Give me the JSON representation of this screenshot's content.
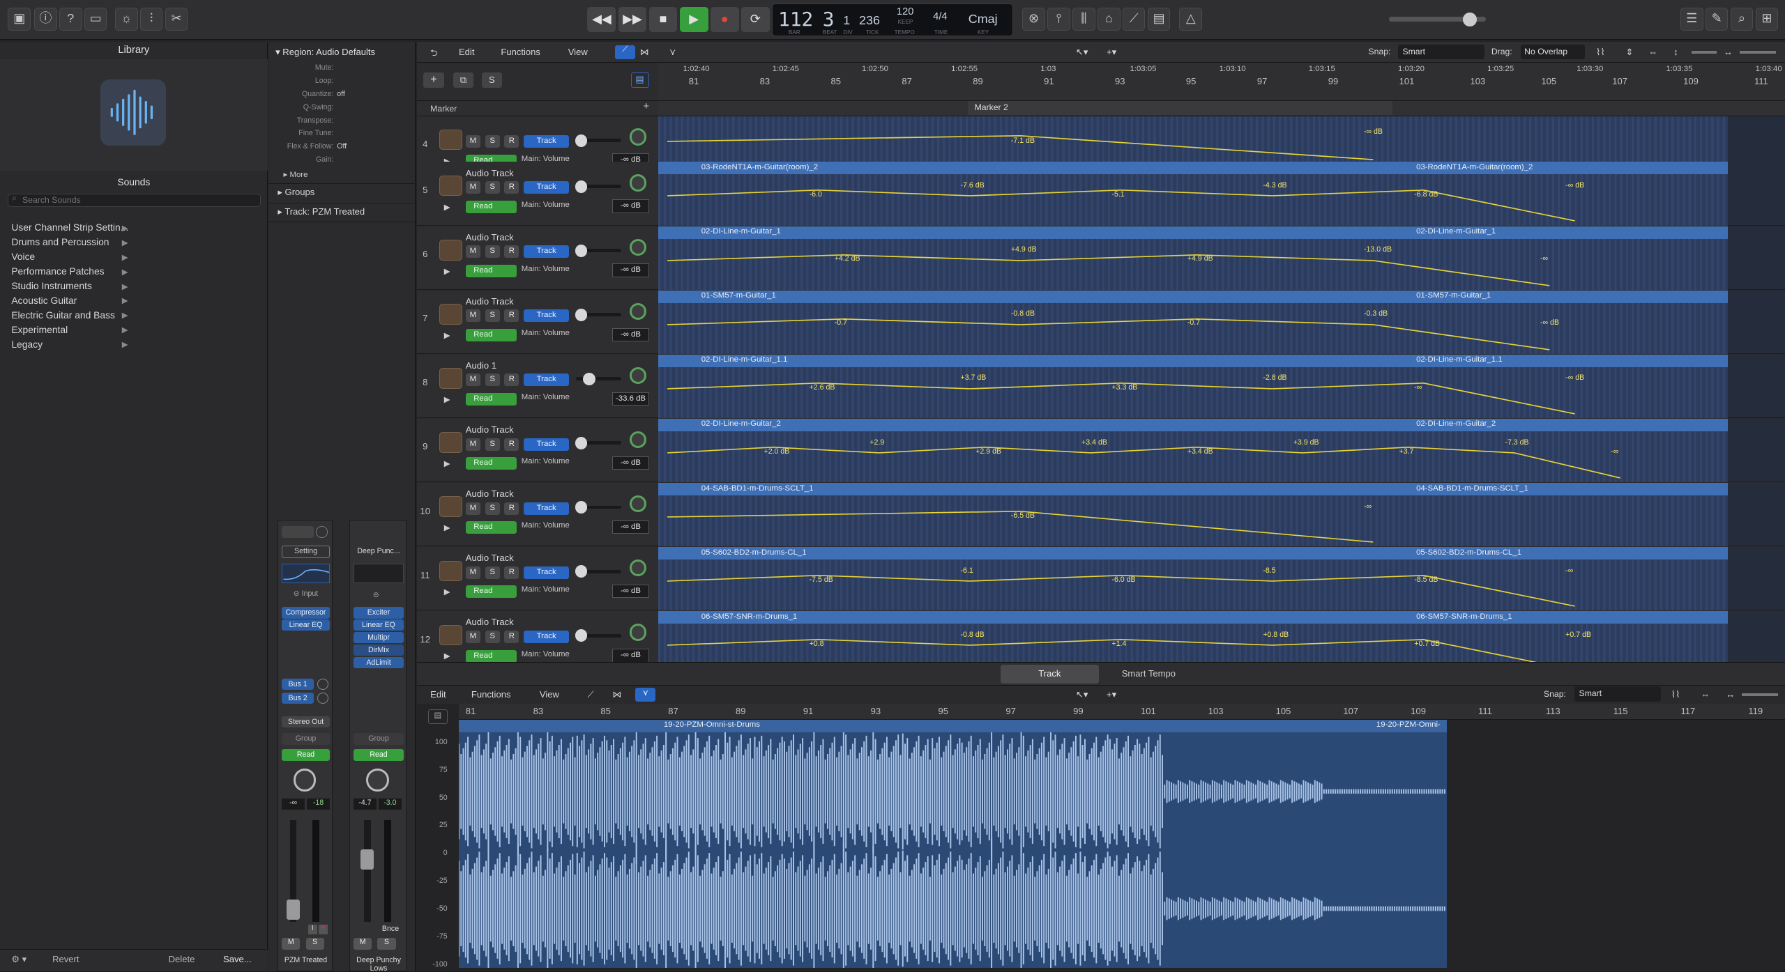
{
  "control_bar": {
    "lcd": {
      "bar": "112",
      "beat": "3",
      "div": "1",
      "tick": "236",
      "bar_lbl": "BAR",
      "beat_lbl": "BEAT",
      "div_lbl": "DIV",
      "tick_lbl": "TICK",
      "tempo": "120",
      "tempo_mode": "KEEP",
      "tempo_lbl": "TEMPO",
      "time_sig": "4/4",
      "time_lbl": "TIME",
      "key": "Cmaj",
      "key_lbl": "KEY"
    }
  },
  "library": {
    "title": "Library",
    "sounds": "Sounds",
    "search_placeholder": "Search Sounds",
    "items": [
      "User Channel Strip Settin...",
      "Drums and Percussion",
      "Voice",
      "Performance Patches",
      "Studio Instruments",
      "Acoustic Guitar",
      "Electric Guitar and Bass",
      "Experimental",
      "Legacy"
    ],
    "footer": {
      "revert": "Revert",
      "delete": "Delete",
      "save": "Save..."
    }
  },
  "inspector": {
    "region_header": "Region: Audio Defaults",
    "params": [
      {
        "label": "Mute:",
        "value": ""
      },
      {
        "label": "Loop:",
        "value": ""
      },
      {
        "label": "Quantize:",
        "value": "off"
      },
      {
        "label": "Q-Swing:",
        "value": ""
      },
      {
        "label": "Transpose:",
        "value": ""
      },
      {
        "label": "Fine Tune:",
        "value": ""
      },
      {
        "label": "Flex & Follow:",
        "value": "Off"
      },
      {
        "label": "Gain:",
        "value": ""
      }
    ],
    "more": "More",
    "groups": "Groups",
    "track_prefix": "Track:",
    "track_name": "PZM  Treated",
    "strip1": {
      "setting": "Setting",
      "input": "Input",
      "plugins": [
        "Compressor",
        "Linear EQ"
      ],
      "sends": [
        "Bus 1",
        "Bus 2"
      ],
      "output": "Stereo Out",
      "group": "Group",
      "read": "Read",
      "vol": "-∞",
      "peak": "-18",
      "m": "M",
      "s": "S",
      "i": "I",
      "r": "R",
      "name": "PZM  Treated"
    },
    "strip2": {
      "setting": "Deep Punc...",
      "plugins": [
        "Exciter",
        "Linear EQ",
        "Multipr",
        "DirMix",
        "AdLimit"
      ],
      "group": "Group",
      "read": "Read",
      "vol": "-4.7",
      "peak": "-3.0",
      "m": "M",
      "s": "S",
      "bnce": "Bnce",
      "name": "Deep Punchy Lows"
    }
  },
  "tracks_toolbar": {
    "edit": "Edit",
    "functions": "Functions",
    "view": "View",
    "snap_label": "Snap:",
    "snap": "Smart",
    "drag_label": "Drag:",
    "drag": "No Overlap",
    "marker": "Marker",
    "marker2": "Marker 2",
    "s": "S"
  },
  "ruler": {
    "times": [
      "1:02:40",
      "1:02:45",
      "1:02:50",
      "1:02:55",
      "1:03",
      "1:03:05",
      "1:03:10",
      "1:03:15",
      "1:03:20",
      "1:03:25",
      "1:03:30",
      "1:03:35",
      "1:03:40"
    ],
    "bars": [
      "81",
      "83",
      "85",
      "87",
      "89",
      "91",
      "93",
      "95",
      "97",
      "99",
      "101",
      "103",
      "105",
      "107",
      "109",
      "111"
    ]
  },
  "tracks": [
    {
      "num": "4",
      "name": "",
      "db": "-∞ dB",
      "regions": [],
      "labels": [
        "-7.1 dB",
        "-∞ dB"
      ]
    },
    {
      "num": "5",
      "name": "Audio Track",
      "db": "-∞ dB",
      "regions": [
        "03-RodeNT1A-m-Guitar(room)_2",
        "03-RodeNT1A-m-Guitar(room)_2"
      ],
      "labels": [
        "-6.0",
        "-7.6 dB",
        "-5.1",
        "-4.3 dB",
        "-6.8 dB",
        "-∞ dB"
      ]
    },
    {
      "num": "6",
      "name": "Audio Track",
      "db": "-∞ dB",
      "regions": [
        "02-DI-Line-m-Guitar_1",
        "02-DI-Line-m-Guitar_1"
      ],
      "labels": [
        "+4.2 dB",
        "+4.9 dB",
        "+4.9 dB",
        "-13.0 dB",
        "-∞"
      ]
    },
    {
      "num": "7",
      "name": "Audio Track",
      "db": "-∞ dB",
      "regions": [
        "01-SM57-m-Guitar_1",
        "01-SM57-m-Guitar_1"
      ],
      "labels": [
        "-0.7",
        "-0.8 dB",
        "-0.7",
        "-0.3 dB",
        "-∞ dB"
      ]
    },
    {
      "num": "8",
      "name": "Audio 1",
      "db": "-33.6 dB",
      "regions": [
        "02-DI-Line-m-Guitar_1.1",
        "02-DI-Line-m-Guitar_1.1"
      ],
      "labels": [
        "+2.6 dB",
        "+3.7 dB",
        "+3.3 dB",
        "-2.8 dB",
        "-∞",
        "-∞ dB"
      ]
    },
    {
      "num": "9",
      "name": "Audio Track",
      "db": "-∞ dB",
      "regions": [
        "02-DI-Line-m-Guitar_2",
        "02-DI-Line-m-Guitar_2"
      ],
      "labels": [
        "+2.0 dB",
        "+2.9",
        "+2.9 dB",
        "+3.4 dB",
        "+3.4 dB",
        "+3.9 dB",
        "+3.7",
        "-7.3 dB",
        "-∞"
      ]
    },
    {
      "num": "10",
      "name": "Audio Track",
      "db": "-∞ dB",
      "regions": [
        "04-SAB-BD1-m-Drums-SCLT_1",
        "04-SAB-BD1-m-Drums-SCLT_1"
      ],
      "labels": [
        "-6.5 dB",
        "-∞"
      ]
    },
    {
      "num": "11",
      "name": "Audio Track",
      "db": "-∞ dB",
      "regions": [
        "05-S602-BD2-m-Drums-CL_1",
        "05-S602-BD2-m-Drums-CL_1"
      ],
      "labels": [
        "-7.5 dB",
        "-6.1",
        "-6.0 dB",
        "-8.5",
        "-8.5 dB",
        "-∞"
      ]
    },
    {
      "num": "12",
      "name": "Audio Track",
      "db": "-∞ dB",
      "regions": [
        "06-SM57-SNR-m-Drums_1",
        "06-SM57-SNR-m-Drums_1"
      ],
      "labels": [
        "+0.8",
        "-0.8 dB",
        "+1.4",
        "+0.8 dB",
        "+0.7 dB",
        "+0.7 dB"
      ]
    }
  ],
  "track_common": {
    "m": "M",
    "s": "S",
    "r": "R",
    "track": "Track",
    "read": "Read",
    "volume": "Main: Volume"
  },
  "editor": {
    "tabs": [
      "Track",
      "Smart Tempo"
    ],
    "edit": "Edit",
    "functions": "Functions",
    "view": "View",
    "snap_label": "Snap:",
    "snap": "Smart",
    "bars": [
      "81",
      "83",
      "85",
      "87",
      "89",
      "91",
      "93",
      "95",
      "97",
      "99",
      "101",
      "103",
      "105",
      "107",
      "109",
      "111",
      "113",
      "115",
      "117",
      "119"
    ],
    "region": "19-20-PZM-Omni-st-Drums",
    "region2": "19-20-PZM-Omni-",
    "yaxis": [
      "100",
      "75",
      "50",
      "25",
      "0",
      "-25",
      "-50",
      "-75",
      "-100"
    ]
  },
  "colors": {
    "accent": "#2a66c4",
    "read": "#37a03c",
    "region": "#3f6fb5",
    "automation": "#e6d33a",
    "play": "#37a03c",
    "record": "#e0473a"
  }
}
